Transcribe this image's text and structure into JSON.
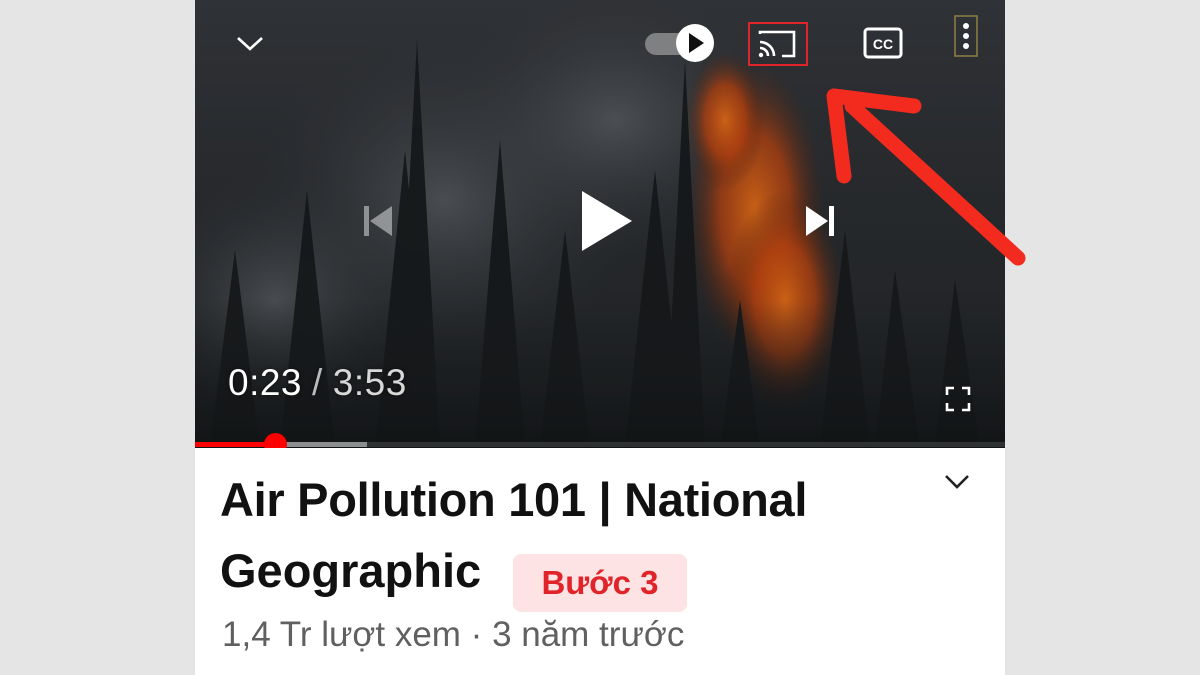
{
  "player": {
    "current_time": "0:23",
    "separator": "/",
    "duration": "3:53",
    "progress_fraction": 0.099,
    "buffer_fraction": 0.212,
    "autoplay": "on",
    "icons": {
      "collapse": "chevron-down-icon",
      "autoplay": "autoplay-toggle-icon",
      "cast": "cast-icon",
      "captions": "captions-icon",
      "more": "more-vertical-icon",
      "previous": "previous-icon",
      "play": "play-icon",
      "next": "next-icon",
      "fullscreen": "fullscreen-icon"
    },
    "captions_label": "CC",
    "highlight_color": "#e0242a"
  },
  "video": {
    "title_line1": "Air Pollution 101 | National",
    "title_line2": "Geographic",
    "views": "1,4 Tr lượt xem",
    "dot": "·",
    "age": "3 năm trước"
  },
  "annotation": {
    "step_label": "Bước 3",
    "color": "#f22b1e"
  },
  "colors": {
    "progress": "#ff0000",
    "badge_bg": "#fde3e3",
    "badge_text": "#e0242a"
  }
}
